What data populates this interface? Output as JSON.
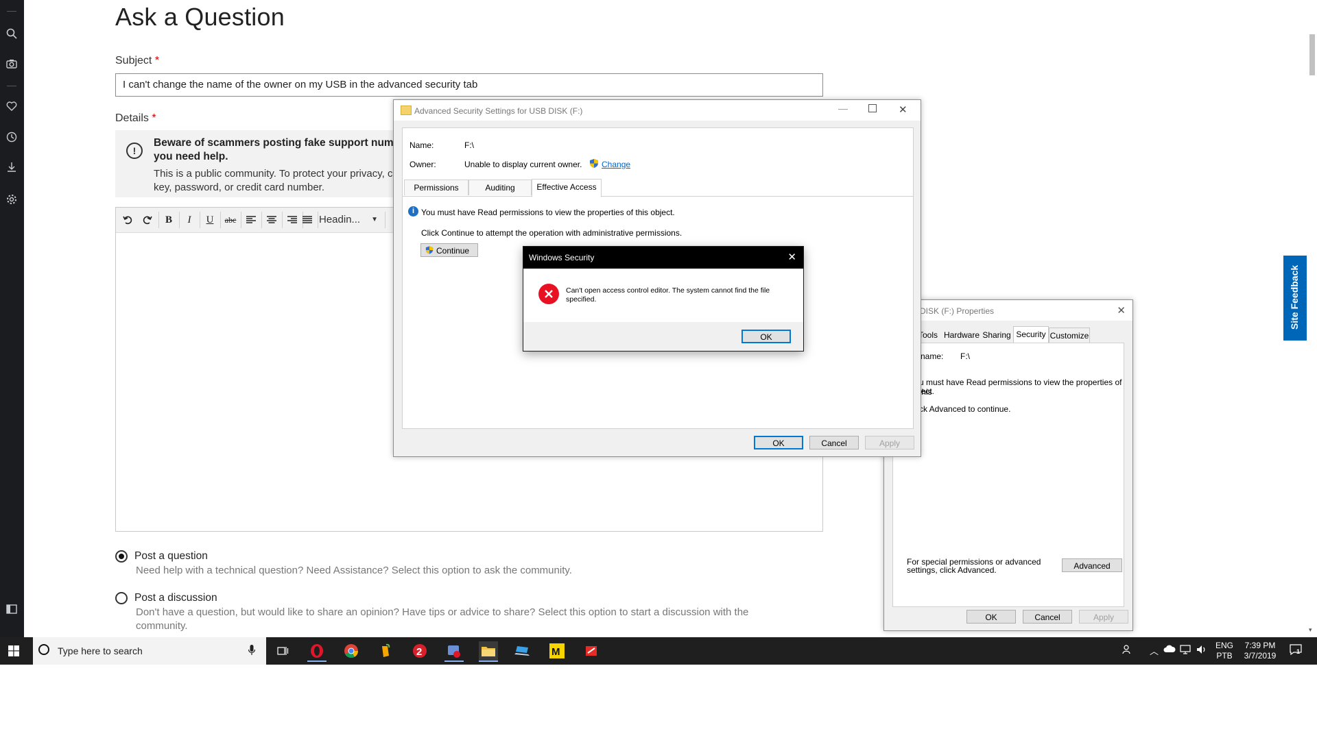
{
  "page": {
    "title": "Ask a Question",
    "subject_label": "Subject",
    "required_mark": "*",
    "subject_value": "I can't change the name of the owner on my USB in the advanced security tab",
    "details_label": "Details",
    "notice_title": "Beware of scammers posting fake support numbers here. Never share personal information when you need help.",
    "notice_body": "This is a public community. To protect your privacy, do not post any personal information such as your product key, password, or credit card number.",
    "notice_title_visible": "Beware of scammers posting fake support numbers",
    "notice_title_line2": "you need help.",
    "notice_body_line1": "This is a public community. To protect your privacy, c",
    "notice_body_line2": "key, password, or credit card number.",
    "heading_select": "Headin...",
    "post_question_label": "Post a question",
    "post_question_desc": "Need help with a technical question? Need Assistance? Select this option to ask the community.",
    "post_discussion_label": "Post a discussion",
    "post_discussion_desc": "Don't have a question, but would like to share an opinion? Have tips or advice to share? Select this option to start a discussion with the community.",
    "site_feedback": "Site Feedback"
  },
  "advanced_security": {
    "title": "Advanced Security Settings for USB DISK (F:)",
    "name_label": "Name:",
    "name_value": "F:\\",
    "owner_label": "Owner:",
    "owner_value": "Unable to display current owner.",
    "change_link": "Change",
    "tabs": [
      "Permissions",
      "Auditing",
      "Effective Access"
    ],
    "info_text": "You must have Read permissions to view the properties of this object.",
    "continue_hint": "Click Continue to attempt the operation with administrative permissions.",
    "continue_button": "Continue",
    "ok": "OK",
    "cancel": "Cancel",
    "apply": "Apply"
  },
  "windows_security": {
    "title": "Windows Security",
    "message": "Can't open access control editor. The system cannot find the file specified.",
    "ok": "OK"
  },
  "properties": {
    "title": "DISK (F:) Properties",
    "tabs": [
      "Tools",
      "Hardware",
      "Sharing",
      "Security",
      "Customize"
    ],
    "object_label": "name:",
    "object_value": "F:\\",
    "read_msg": "u must have Read permissions to view the properties of this",
    "read_msg2": "ject.",
    "advanced_msg": "ck Advanced to continue.",
    "special_perm": "For special permissions or advanced settings, click Advanced.",
    "advanced_button": "Advanced",
    "ok": "OK",
    "cancel": "Cancel",
    "apply": "Apply"
  },
  "taskbar": {
    "search_placeholder": "Type here to search",
    "lang": "ENG",
    "layout": "PTB",
    "time": "7:39 PM",
    "date": "3/7/2019",
    "notification_count": "1"
  },
  "colors": {
    "accent": "#0078d7",
    "error": "#e81123",
    "sidebar": "#1b1c1f",
    "taskbar": "#1f1f1f",
    "feedback": "#0067b8"
  }
}
